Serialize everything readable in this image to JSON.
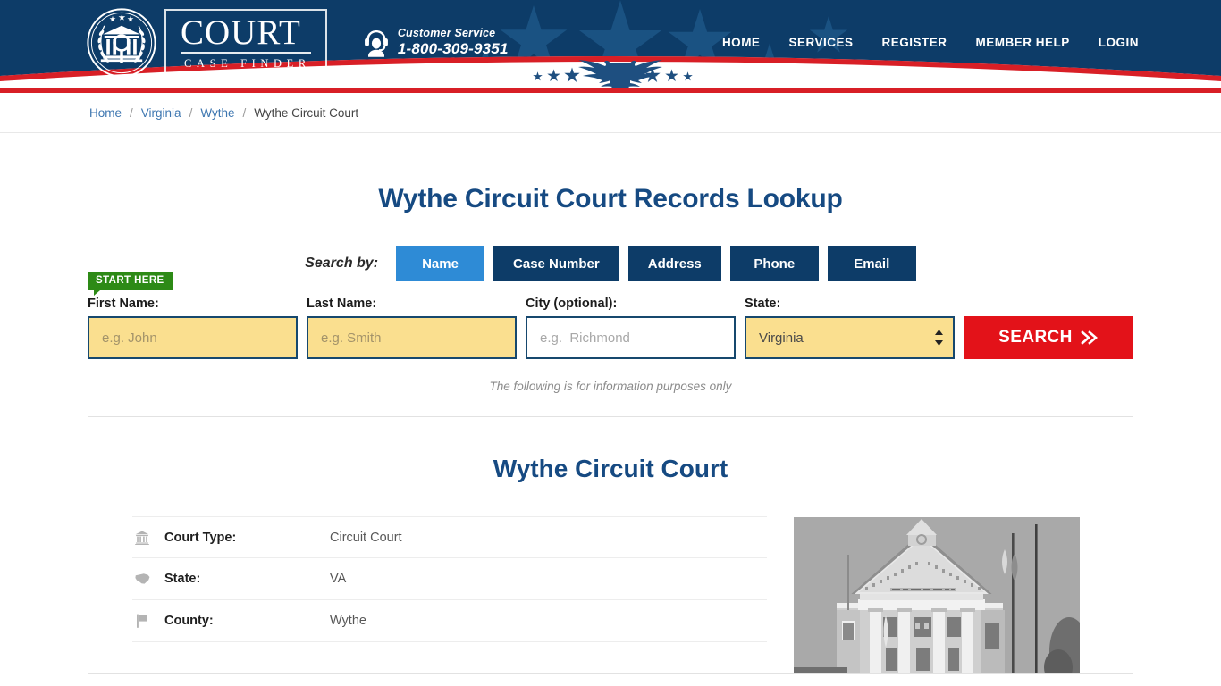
{
  "header": {
    "logo": {
      "icon": "court-seal-icon",
      "title": "COURT",
      "subtitle": "CASE FINDER"
    },
    "customer_service": {
      "icon": "headset-support-icon",
      "label": "Customer Service",
      "phone": "1-800-309-9351"
    },
    "nav": [
      {
        "label": "HOME"
      },
      {
        "label": "SERVICES"
      },
      {
        "label": "REGISTER"
      },
      {
        "label": "MEMBER HELP"
      },
      {
        "label": "LOGIN"
      }
    ],
    "colors": {
      "navy": "#0d3c68",
      "red": "#d81f26",
      "white": "#ffffff"
    }
  },
  "breadcrumb": {
    "items": [
      {
        "label": "Home",
        "current": false
      },
      {
        "label": "Virginia",
        "current": false
      },
      {
        "label": "Wythe",
        "current": false
      },
      {
        "label": "Wythe Circuit Court",
        "current": true
      }
    ],
    "separator": "/"
  },
  "main": {
    "page_title": "Wythe Circuit Court Records Lookup",
    "search_by_label": "Search by:",
    "tabs": [
      {
        "label": "Name",
        "active": true
      },
      {
        "label": "Case Number",
        "active": false
      },
      {
        "label": "Address",
        "active": false
      },
      {
        "label": "Phone",
        "active": false
      },
      {
        "label": "Email",
        "active": false
      }
    ],
    "start_here_badge": "START HERE",
    "form": {
      "first_name": {
        "label": "First Name:",
        "value": "",
        "placeholder": "e.g. John"
      },
      "last_name": {
        "label": "Last Name:",
        "value": "",
        "placeholder": "e.g. Smith"
      },
      "city": {
        "label": "City (optional):",
        "value": "",
        "placeholder": "e.g.  Richmond"
      },
      "state": {
        "label": "State:",
        "value": "Virginia",
        "options": [
          "Virginia"
        ]
      },
      "search_button": "SEARCH",
      "search_button_icon": "double-chevron-right-icon"
    },
    "disclaimer": "The following is for information purposes only"
  },
  "card": {
    "title": "Wythe Circuit Court",
    "details": [
      {
        "icon": "bank-building-icon",
        "label": "Court Type:",
        "value": "Circuit Court"
      },
      {
        "icon": "us-map-icon",
        "label": "State:",
        "value": "VA"
      },
      {
        "icon": "flag-icon",
        "label": "County:",
        "value": "Wythe"
      }
    ],
    "photo_alt": "courthouse-photo"
  },
  "colors": {
    "accent_blue": "#164a82",
    "active_tab_blue": "#2e8bd6",
    "search_red": "#e31219",
    "field_yellow": "#fadf8f",
    "badge_green": "#2d8a16"
  }
}
